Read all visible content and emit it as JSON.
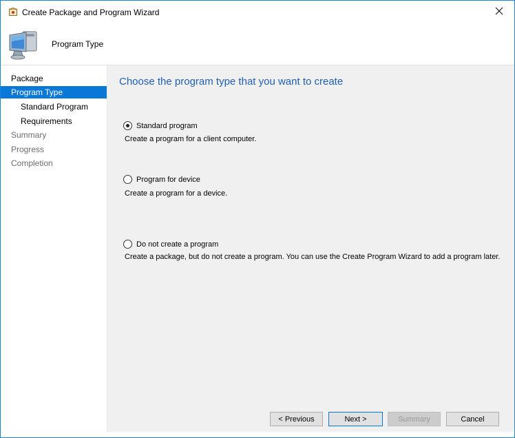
{
  "window": {
    "title": "Create Package and Program Wizard",
    "title_icon": "package-wizard-icon",
    "close_icon": "close-icon"
  },
  "header": {
    "title": "Program Type",
    "icon": "computer-monitor-icon"
  },
  "sidebar": {
    "items": [
      {
        "label": "Package",
        "state": "normal"
      },
      {
        "label": "Program Type",
        "state": "active"
      },
      {
        "label": "Standard Program",
        "state": "normal"
      },
      {
        "label": "Requirements",
        "state": "normal"
      },
      {
        "label": "Summary",
        "state": "disabled"
      },
      {
        "label": "Progress",
        "state": "disabled"
      },
      {
        "label": "Completion",
        "state": "disabled"
      }
    ]
  },
  "main": {
    "heading": "Choose the program type that you want to create",
    "options": [
      {
        "label": "Standard program",
        "description": "Create a program for a client computer.",
        "checked": true
      },
      {
        "label": "Program for device",
        "description": "Create a program for a device.",
        "checked": false
      },
      {
        "label": "Do not create a program",
        "description": "Create a package, but do not create a program. You can use the Create Program Wizard to add a program later.",
        "checked": false
      }
    ]
  },
  "footer": {
    "previous_label": "< Previous",
    "next_label": "Next >",
    "summary_label": "Summary",
    "cancel_label": "Cancel"
  },
  "colors": {
    "accent": "#0a78d7",
    "heading": "#1e5fb4",
    "content_bg": "#f0f0f0"
  }
}
